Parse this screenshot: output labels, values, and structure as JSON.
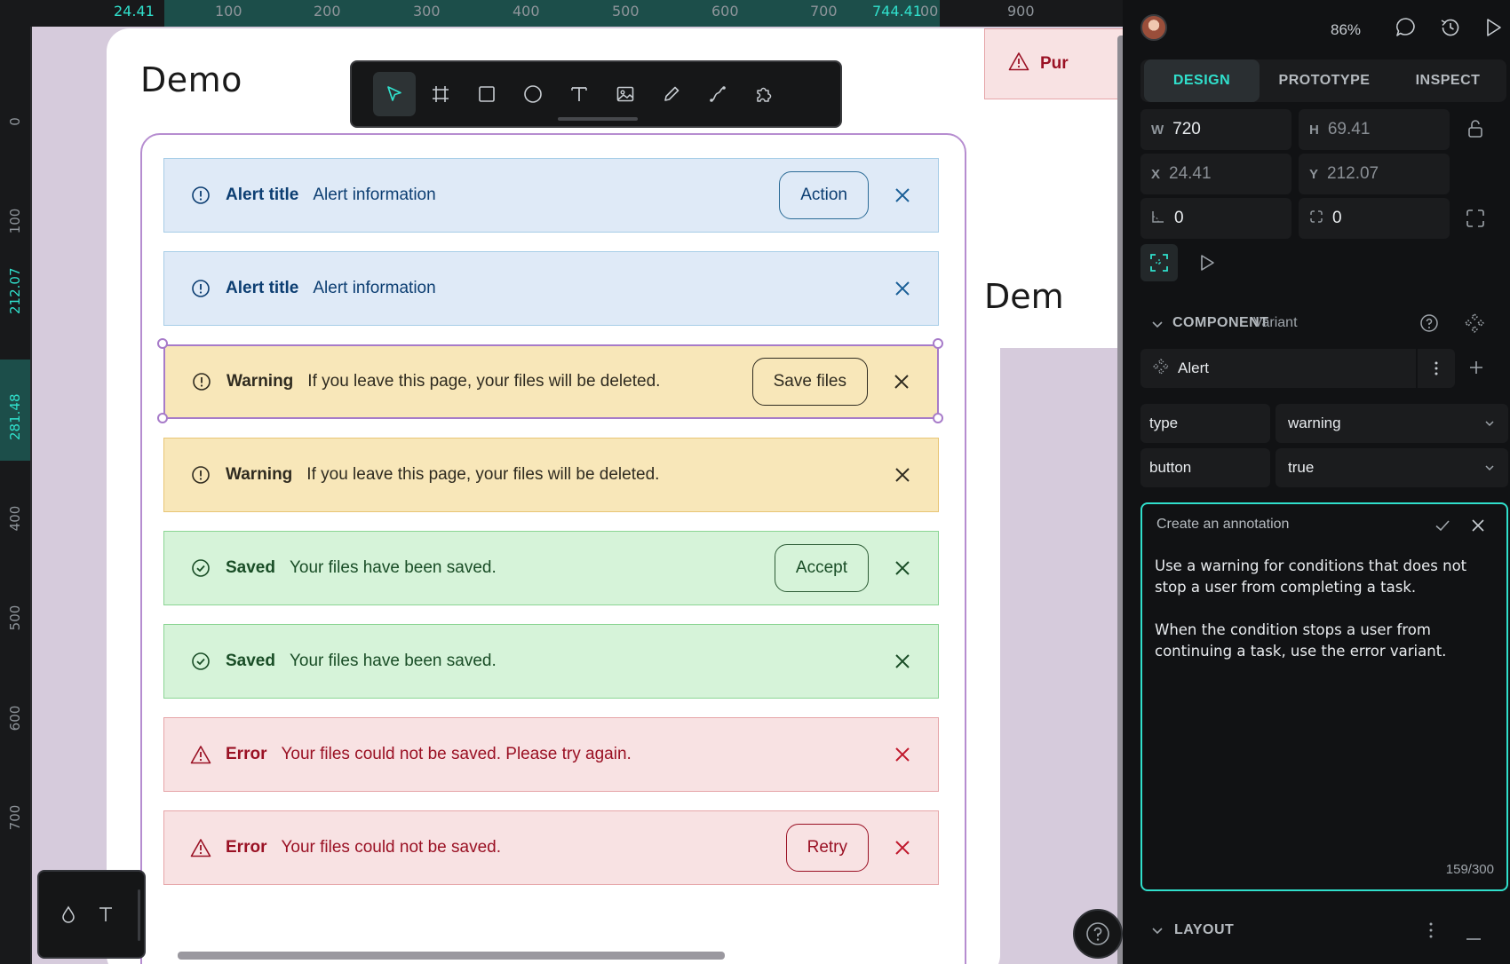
{
  "rulers": {
    "top": [
      "24.41",
      "100",
      "200",
      "300",
      "400",
      "500",
      "600",
      "700",
      "744.41",
      "00",
      "900"
    ],
    "left": [
      "0",
      "100",
      "212.07",
      "281.48",
      "400",
      "500",
      "600",
      "700"
    ]
  },
  "canvas": {
    "board_title": "Demo",
    "board2_title": "Dem",
    "pure_chip": "Pur",
    "alerts": [
      {
        "type": "info",
        "title": "Alert title",
        "message": "Alert information",
        "button": "Action"
      },
      {
        "type": "info",
        "title": "Alert title",
        "message": "Alert information",
        "button": null
      },
      {
        "type": "warning",
        "title": "Warning",
        "message": "If you leave this page, your files will be deleted.",
        "button": "Save files",
        "selected": true
      },
      {
        "type": "warning",
        "title": "Warning",
        "message": "If you leave this page, your files will be deleted.",
        "button": null
      },
      {
        "type": "success",
        "title": "Saved",
        "message": "Your files have been saved.",
        "button": "Accept"
      },
      {
        "type": "success",
        "title": "Saved",
        "message": "Your files have been saved.",
        "button": null
      },
      {
        "type": "error",
        "title": "Error",
        "message": "Your files could not be saved. Please try again.",
        "button": null
      },
      {
        "type": "error",
        "title": "Error",
        "message": "Your files could not be saved.",
        "button": "Retry"
      }
    ]
  },
  "toolbar": {
    "tools": [
      "pointer-icon",
      "board-icon",
      "rectangle-icon",
      "ellipse-icon",
      "text-icon",
      "image-icon",
      "pencil-icon",
      "path-icon",
      "plugins-icon"
    ],
    "active": "pointer-icon"
  },
  "panel": {
    "zoom": "86%",
    "tabs": [
      "DESIGN",
      "PROTOTYPE",
      "INSPECT"
    ],
    "active_tab": "DESIGN",
    "measures": {
      "w_label": "W",
      "w": "720",
      "h_label": "H",
      "h": "69.41",
      "x_label": "X",
      "x": "24.41",
      "y_label": "Y",
      "y": "212.07",
      "rotation": "0",
      "radius": "0"
    },
    "component": {
      "header": "COMPONENT",
      "sub": "Variant",
      "name": "Alert",
      "props": [
        {
          "name": "type",
          "value": "warning"
        },
        {
          "name": "button",
          "value": "true"
        }
      ]
    },
    "annotation": {
      "title": "Create an annotation",
      "text": "Use a warning for conditions that does not stop a user from completing a task.\n\nWhen the condition stops a user from continuing a task, use the error variant.",
      "count": "159/300"
    },
    "layout_header": "LAYOUT"
  },
  "colors": {
    "accent": "#30e0cc",
    "info_text": "#0c3e72",
    "warning_text": "#2f2b20",
    "success_text": "#194d26",
    "error_text": "#9a1124",
    "selection": "#a77bc9"
  }
}
